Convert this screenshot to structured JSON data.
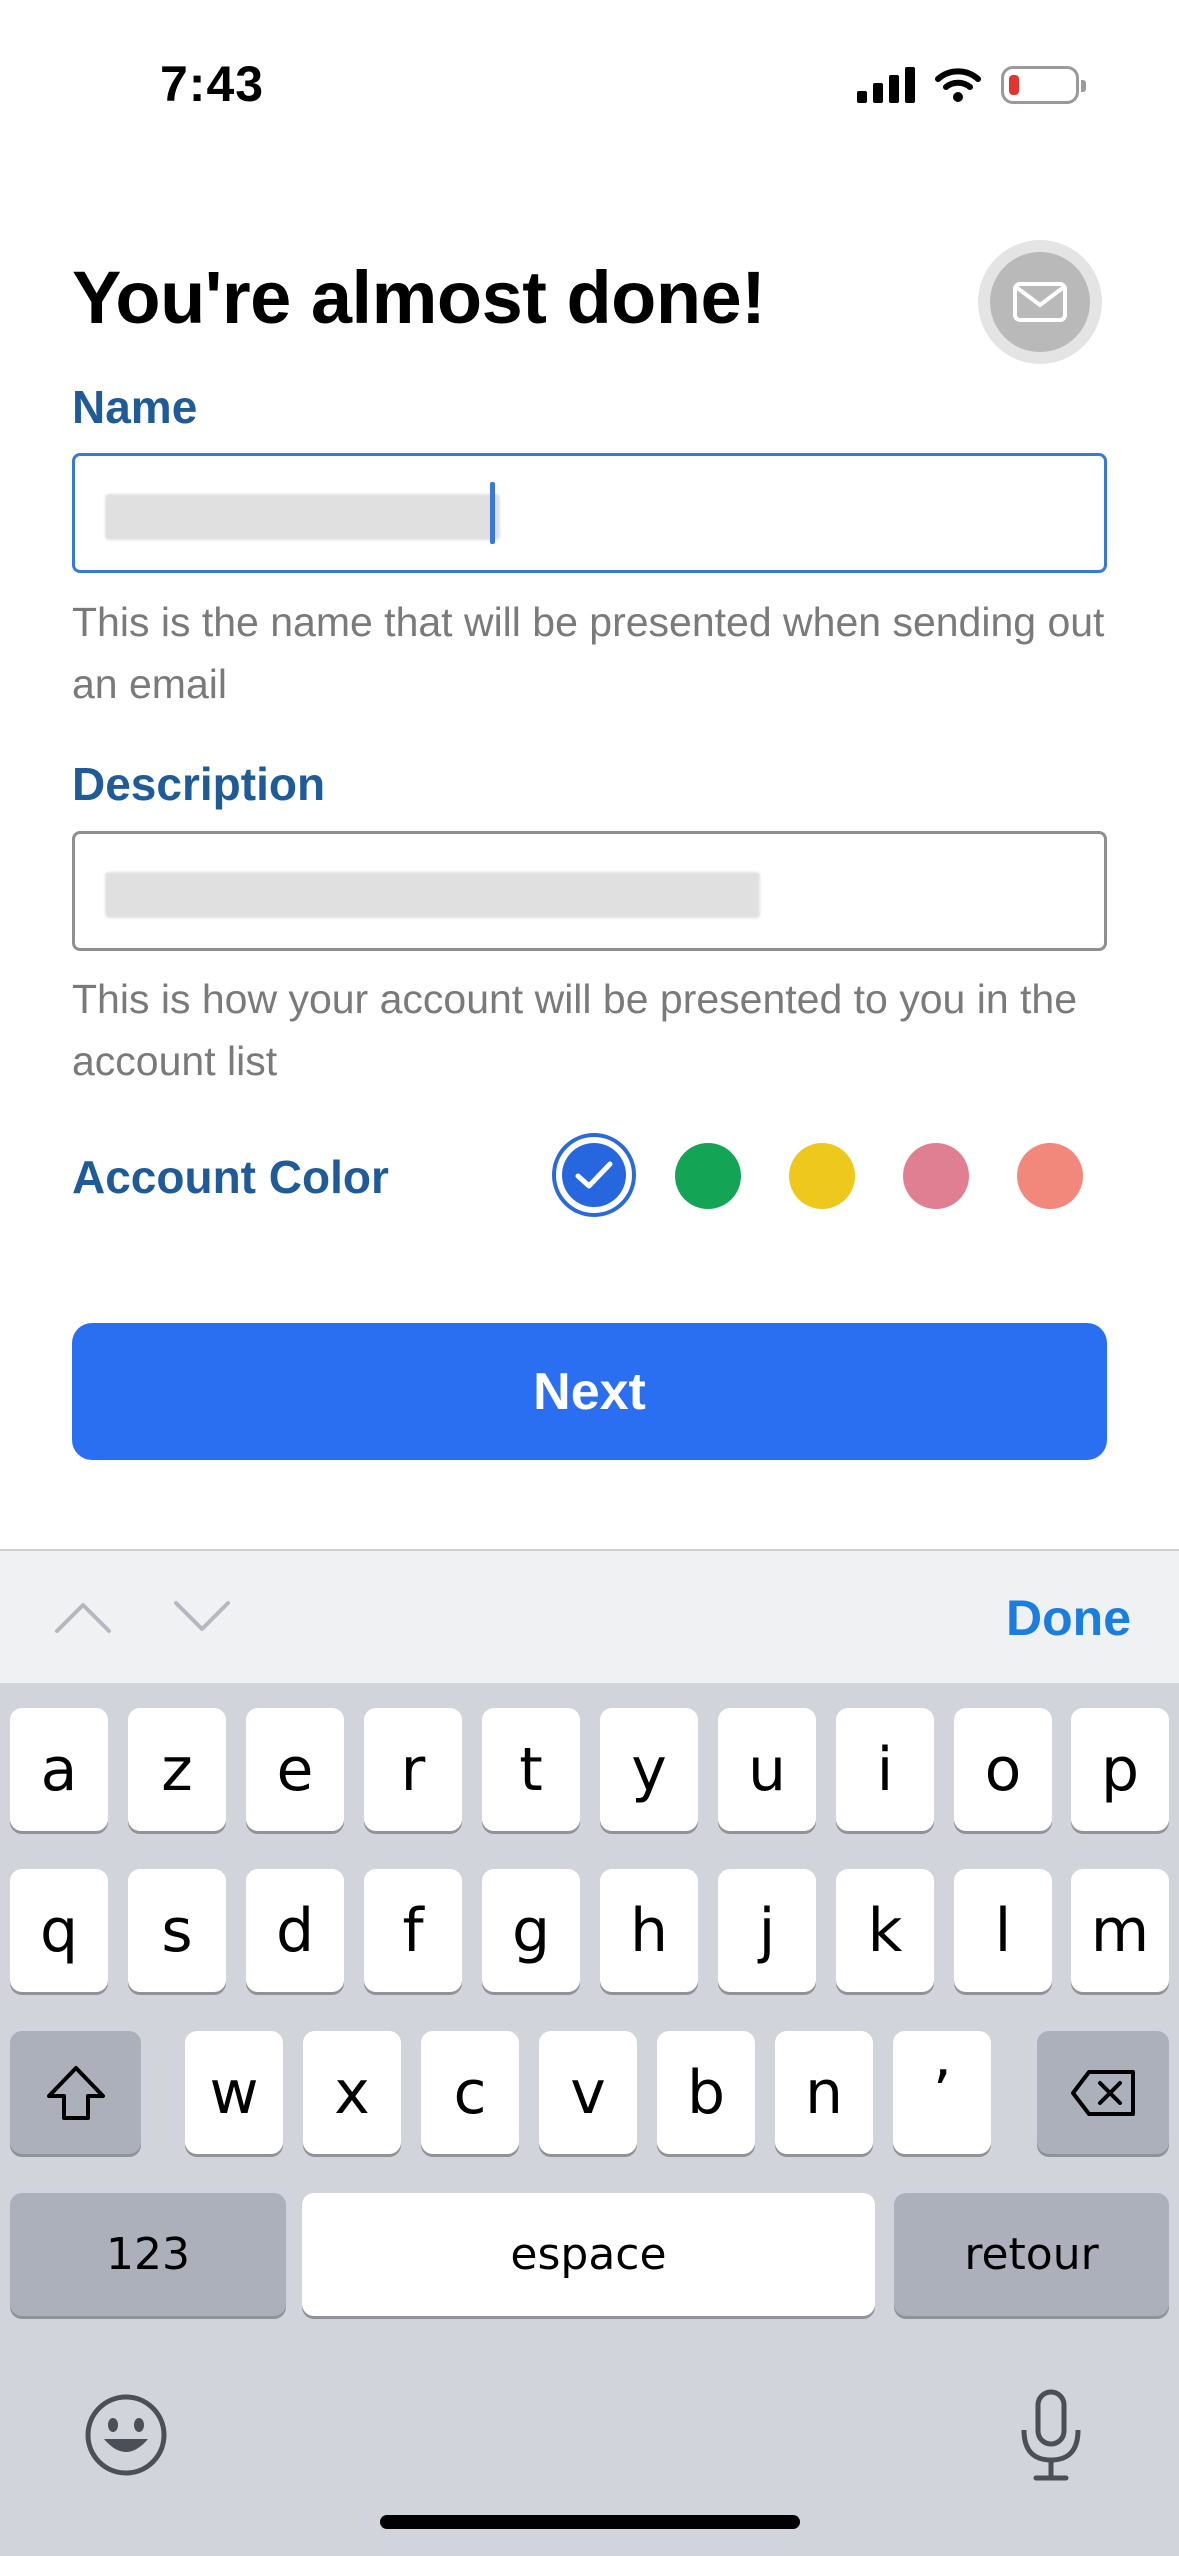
{
  "status_bar": {
    "time": "7:43"
  },
  "header": {
    "title": "You're almost done!",
    "avatar_icon": "mail-icon"
  },
  "form": {
    "name": {
      "label": "Name",
      "help": "This is the name that will be presented when sending out an email"
    },
    "description": {
      "label": "Description",
      "help": "This is how your account will be presented to you in the account list"
    },
    "account_color": {
      "label": "Account Color",
      "options": [
        "#2667e0",
        "#14a455",
        "#eec81c",
        "#e07f91",
        "#f2877b"
      ],
      "selected_index": 0
    },
    "next_label": "Next"
  },
  "accessory": {
    "done_label": "Done"
  },
  "keyboard": {
    "row1": [
      "a",
      "z",
      "e",
      "r",
      "t",
      "y",
      "u",
      "i",
      "o",
      "p"
    ],
    "row2": [
      "q",
      "s",
      "d",
      "f",
      "g",
      "h",
      "j",
      "k",
      "l",
      "m"
    ],
    "row3": [
      "w",
      "x",
      "c",
      "v",
      "b",
      "n",
      "’"
    ],
    "numbers_label": "123",
    "space_label": "espace",
    "return_label": "retour"
  }
}
